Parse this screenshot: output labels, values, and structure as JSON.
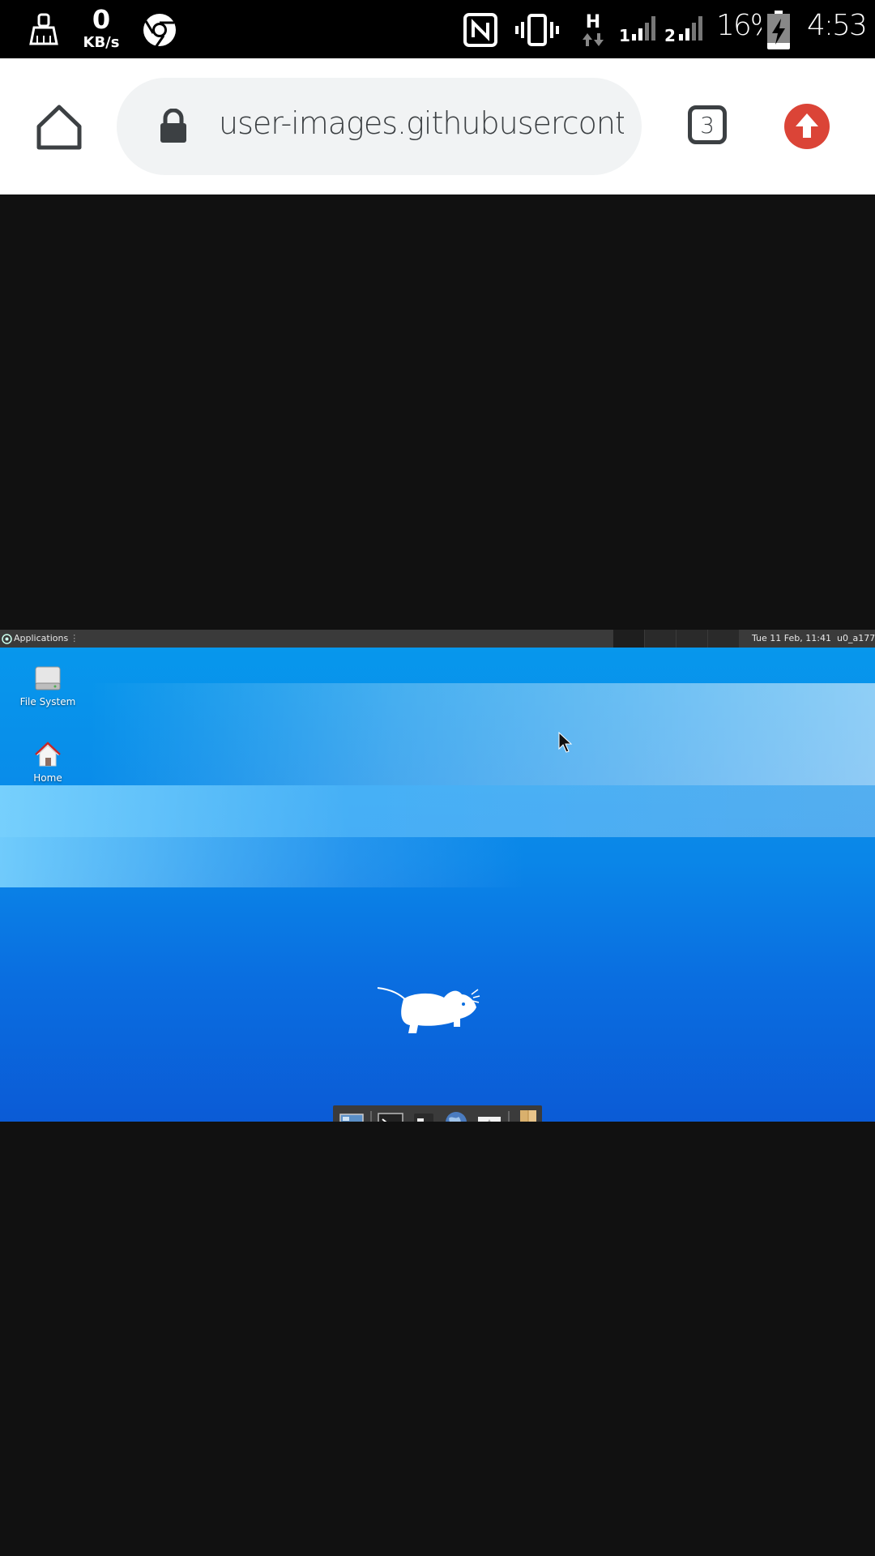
{
  "status_bar": {
    "speed_value": "0",
    "speed_unit": "KB/s",
    "network_type": "H",
    "sim1_label": "1",
    "sim2_label": "2",
    "battery_text": "16%",
    "time": "4:53",
    "icons": [
      "cleaner-icon",
      "chrome-icon",
      "nfc-icon",
      "vibrate-icon",
      "signal-icon",
      "battery-charging-icon"
    ]
  },
  "browser": {
    "url": "user-images.githubusercontent.",
    "tab_count": "3",
    "accent_update": "#db4437",
    "icons": [
      "home-icon",
      "lock-icon",
      "update-arrow-icon"
    ]
  },
  "desktop": {
    "panel": {
      "apps_label": "Applications",
      "clock": "Tue 11 Feb, 11:41",
      "user": "u0_a177"
    },
    "icons": [
      {
        "label": "File System",
        "icon": "drive-icon"
      },
      {
        "label": "Home",
        "icon": "home-folder-icon"
      }
    ],
    "dock_items": [
      "show-desktop-icon",
      "terminal-icon",
      "file-manager-icon",
      "web-browser-icon",
      "app-finder-icon",
      "folder-icon"
    ],
    "wallpaper_color": "#0a86e8"
  }
}
